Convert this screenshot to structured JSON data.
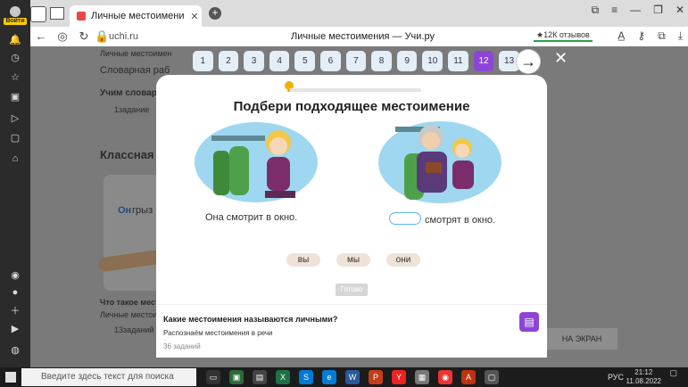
{
  "browser": {
    "login_label": "Войти",
    "tab_title": "Личные местоимени",
    "url": "uchi.ru",
    "page_title": "Личные местоимения — Учи.ру",
    "reviews": "★12К отзывов"
  },
  "background_page": {
    "header_text": "Личные местоимен",
    "work_line": "Словарная раб",
    "learn_title": "Учим словарн",
    "learn_sub": "1задание",
    "section_title": "Классная р",
    "card_text_blue": "Он",
    "card_text_rest": " грыз",
    "what_title": "Что такое мест",
    "what_sub": "Личные местои",
    "what_count": "13заданий",
    "side_button": "НА ЭКРАН"
  },
  "modal": {
    "numbers": [
      "1",
      "2",
      "3",
      "4",
      "5",
      "6",
      "7",
      "8",
      "9",
      "10",
      "11",
      "12",
      "13"
    ],
    "active_number": "12",
    "progress": 0.02,
    "question": "Подбери подходящее местоимение",
    "left_sentence": "Она смотрит в окно.",
    "right_sentence_rest": "смотрят в окно.",
    "choices": [
      "вы",
      "мы",
      "они"
    ],
    "ready_label": "Готово",
    "info_title": "Какие местоимения называются личными?",
    "info_sub": "Распознаём местоимения в речи",
    "info_count": "36 заданий"
  },
  "taskbar": {
    "search_placeholder": "Введите здесь текст для поиска",
    "lang": "РУС",
    "time": "21:12",
    "date": "11.08.2022"
  }
}
